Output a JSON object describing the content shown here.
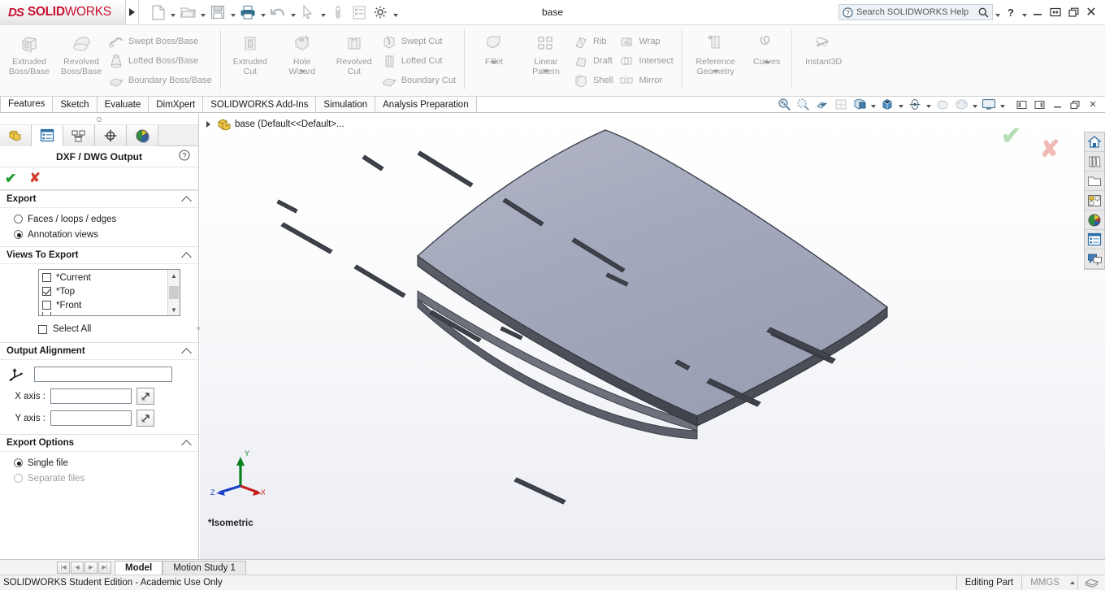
{
  "titlebar": {
    "brand_ds": "DS",
    "brand_solid": "SOLID",
    "brand_works": "WORKS",
    "document_title": "base",
    "search_placeholder": "Search SOLIDWORKS Help",
    "help_label": "?",
    "minimize_label": "—",
    "restore_label": "❐",
    "close_label": "✕",
    "quick_access": [
      {
        "name": "new-document",
        "icon": "new-file-icon",
        "has_caret": true
      },
      {
        "name": "open-document",
        "icon": "open-folder-icon",
        "has_caret": true
      },
      {
        "name": "save-document",
        "icon": "save-disk-icon",
        "has_caret": true
      },
      {
        "name": "print-document",
        "icon": "printer-icon",
        "has_caret": true
      },
      {
        "name": "undo",
        "icon": "undo-arrow-icon",
        "has_caret": true
      },
      {
        "name": "select",
        "icon": "cursor-arrow-icon",
        "has_caret": true
      },
      {
        "name": "rebuild",
        "icon": "rebuild-icon",
        "has_caret": false
      },
      {
        "name": "file-properties",
        "icon": "properties-list-icon",
        "has_caret": false
      },
      {
        "name": "options",
        "icon": "gear-icon",
        "has_caret": true
      }
    ]
  },
  "ribbon": {
    "groups": [
      {
        "name": "boss-base-group",
        "big": [
          {
            "label": "Extruded\nBoss/Base",
            "label_line1": "Extruded",
            "label_line2": "Boss/Base",
            "icon": "extruded-boss-icon"
          },
          {
            "label_line1": "Revolved",
            "label_line2": "Boss/Base",
            "icon": "revolved-boss-icon"
          }
        ],
        "small": [
          {
            "label": "Swept Boss/Base",
            "icon": "swept-boss-icon"
          },
          {
            "label": "Lofted Boss/Base",
            "icon": "lofted-boss-icon"
          },
          {
            "label": "Boundary Boss/Base",
            "icon": "boundary-boss-icon"
          }
        ]
      },
      {
        "name": "cut-group",
        "big": [
          {
            "label_line1": "Extruded",
            "label_line2": "Cut",
            "icon": "extruded-cut-icon"
          },
          {
            "label_line1": "Hole",
            "label_line2": "Wizard",
            "icon": "hole-wizard-icon",
            "caret": true
          },
          {
            "label_line1": "Revolved",
            "label_line2": "Cut",
            "icon": "revolved-cut-icon"
          }
        ],
        "small": [
          {
            "label": "Swept Cut",
            "icon": "swept-cut-icon"
          },
          {
            "label": "Lofted Cut",
            "icon": "lofted-cut-icon"
          },
          {
            "label": "Boundary Cut",
            "icon": "boundary-cut-icon"
          }
        ]
      },
      {
        "name": "feature-group",
        "big": [
          {
            "label_line1": "Fillet",
            "label_line2": "",
            "icon": "fillet-icon",
            "caret": true
          },
          {
            "label_line1": "Linear",
            "label_line2": "Pattern",
            "icon": "linear-pattern-icon",
            "caret": true
          }
        ],
        "small": [
          {
            "label": "Rib",
            "icon": "rib-icon"
          },
          {
            "label": "Draft",
            "icon": "draft-icon"
          },
          {
            "label": "Shell",
            "icon": "shell-icon"
          }
        ],
        "small2": [
          {
            "label": "Wrap",
            "icon": "wrap-icon"
          },
          {
            "label": "Intersect",
            "icon": "intersect-icon"
          },
          {
            "label": "Mirror",
            "icon": "mirror-icon"
          }
        ]
      },
      {
        "name": "reference-group",
        "big": [
          {
            "label_line1": "Reference",
            "label_line2": "Geometry",
            "icon": "reference-geometry-icon",
            "caret": true
          },
          {
            "label_line1": "Curves",
            "label_line2": "",
            "icon": "curves-icon",
            "caret": true
          }
        ]
      },
      {
        "name": "instant3d-group",
        "big": [
          {
            "label_line1": "Instant3D",
            "label_line2": "",
            "icon": "instant3d-icon"
          }
        ]
      }
    ]
  },
  "tabs": {
    "items": [
      {
        "label": "Features",
        "active": true
      },
      {
        "label": "Sketch",
        "active": false
      },
      {
        "label": "Evaluate",
        "active": false
      },
      {
        "label": "DimXpert",
        "active": false
      },
      {
        "label": "SOLIDWORKS Add-Ins",
        "active": false
      },
      {
        "label": "Simulation",
        "active": false
      },
      {
        "label": "Analysis Preparation",
        "active": false
      }
    ],
    "view_tools": [
      {
        "name": "zoom-to-fit-icon",
        "caret": false
      },
      {
        "name": "zoom-to-area-icon",
        "caret": false
      },
      {
        "name": "section-view-icon",
        "caret": false
      },
      {
        "name": "view-orientation-icon",
        "caret": false
      },
      {
        "name": "display-style-icon",
        "caret": true
      },
      {
        "name": "hide-show-items-icon",
        "caret": true
      },
      {
        "name": "edit-appearance-icon",
        "caret": true
      },
      {
        "name": "apply-scene-icon",
        "caret": true
      },
      {
        "name": "view-settings-icon",
        "caret": true
      }
    ],
    "window_controls": [
      {
        "name": "restore-doc-left",
        "glyph": "◧"
      },
      {
        "name": "restore-doc-right",
        "glyph": "◨"
      },
      {
        "name": "minimize-doc",
        "glyph": "—"
      },
      {
        "name": "restore-doc",
        "glyph": "❐"
      },
      {
        "name": "close-doc",
        "glyph": "✕"
      }
    ]
  },
  "property_manager": {
    "tabs": [
      {
        "name": "feature-manager-tree-tab",
        "icon": "feature-tree-icon",
        "active": false
      },
      {
        "name": "property-manager-tab",
        "icon": "property-list-icon",
        "active": true
      },
      {
        "name": "configuration-manager-tab",
        "icon": "configuration-icon",
        "active": false
      },
      {
        "name": "dimxpert-manager-tab",
        "icon": "dimxpert-target-icon",
        "active": false
      },
      {
        "name": "display-manager-tab",
        "icon": "display-sphere-icon",
        "active": false
      }
    ],
    "title": "DXF / DWG Output",
    "help_icon": "question-mark-icon",
    "accept_icon": "green-check-icon",
    "cancel_icon": "red-x-icon",
    "export": {
      "header": "Export",
      "options": [
        {
          "label": "Faces / loops / edges",
          "selected": false
        },
        {
          "label": "Annotation views",
          "selected": true
        }
      ]
    },
    "views_to_export": {
      "header": "Views To Export",
      "items": [
        {
          "label": "*Current",
          "checked": false
        },
        {
          "label": "*Top",
          "checked": true
        },
        {
          "label": "*Front",
          "checked": false
        }
      ],
      "select_all_label": "Select All",
      "select_all_checked": false
    },
    "output_alignment": {
      "header": "Output Alignment",
      "origin_icon": "triad-origin-icon",
      "origin_value": "",
      "origin_placeholder": "",
      "x_axis_label": "X axis :",
      "x_axis_value": "",
      "y_axis_label": "Y axis :",
      "y_axis_value": "",
      "flip_icon": "flip-direction-icon"
    },
    "export_options": {
      "header": "Export Options",
      "options": [
        {
          "label": "Single file",
          "selected": true,
          "disabled": false
        },
        {
          "label": "Separate files",
          "selected": false,
          "disabled": true
        }
      ]
    }
  },
  "feature_tree": {
    "root_label": "base  (Default<<Default>...",
    "root_icon": "part-document-icon",
    "expand_icon": "expand-triangle-icon"
  },
  "graphics": {
    "view_label": "*Isometric",
    "triad": {
      "x_label": "X",
      "y_label": "Y",
      "z_label": "Z"
    },
    "confirm_ok_icon": "confirm-check-icon",
    "confirm_cancel_icon": "confirm-x-icon",
    "right_toolbar": [
      {
        "name": "home-icon"
      },
      {
        "name": "design-library-icon"
      },
      {
        "name": "file-explorer-icon"
      },
      {
        "name": "view-palette-icon"
      },
      {
        "name": "appearances-scenes-icon"
      },
      {
        "name": "custom-properties-icon"
      },
      {
        "name": "comments-icon"
      }
    ],
    "model": {
      "name": "base",
      "description": "curved plate with slot cutouts",
      "face_color": "#a0a4b8",
      "edge_color": "#3c3f46",
      "slot_count": 10
    }
  },
  "bottom": {
    "nav_buttons": [
      "|◀",
      "◀",
      "▶",
      "▶|"
    ],
    "tabs": [
      {
        "label": "Model",
        "active": true
      },
      {
        "label": "Motion Study 1",
        "active": false
      }
    ]
  },
  "statusbar": {
    "message": "SOLIDWORKS Student Edition - Academic Use Only",
    "editing_state": "Editing Part",
    "units": "MMGS",
    "units_caret_icon": "up-caret-icon",
    "overlay_icon": "sheet-stack-icon"
  }
}
